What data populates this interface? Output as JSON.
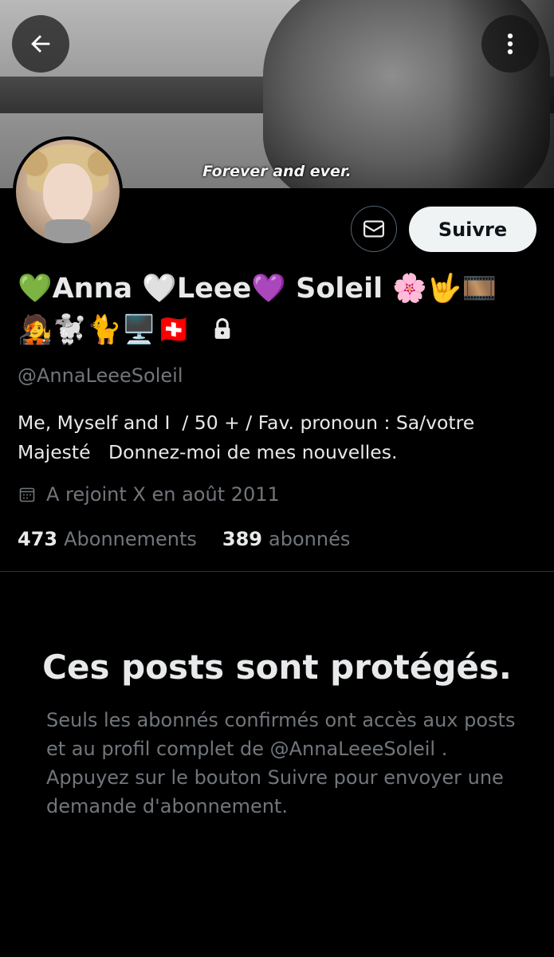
{
  "banner": {
    "subtitle": "Forever and ever."
  },
  "header": {
    "back_icon": "arrow-left-icon",
    "more_icon": "kebab-vertical-icon"
  },
  "actions": {
    "message_icon": "envelope-icon",
    "follow_label": "Suivre"
  },
  "profile": {
    "display_name_line1": "💚Anna 🤍Leee💜 Soleil 🌸🤟🎞️",
    "display_name_line2": "🧑‍🎤🐩🐈🖥️🇨🇭",
    "protected_icon": "lock-icon",
    "handle": "@AnnaLeeeSoleil",
    "bio": "Me, Myself and I  / 50 + / Fav. pronoun : Sa/votre Majesté   Donnez-moi de mes nouvelles.",
    "joined_icon": "calendar-icon",
    "joined": "A rejoint X en août 2011"
  },
  "stats": {
    "following_count": "473",
    "following_label": "Abonnements",
    "followers_count": "389",
    "followers_label": "abonnés"
  },
  "protected": {
    "title": "Ces posts sont protégés.",
    "text": "Seuls les abonnés confirmés ont accès aux posts et au profil complet de @AnnaLeeeSoleil . Appuyez sur le bouton Suivre pour envoyer une demande d'abonnement."
  }
}
